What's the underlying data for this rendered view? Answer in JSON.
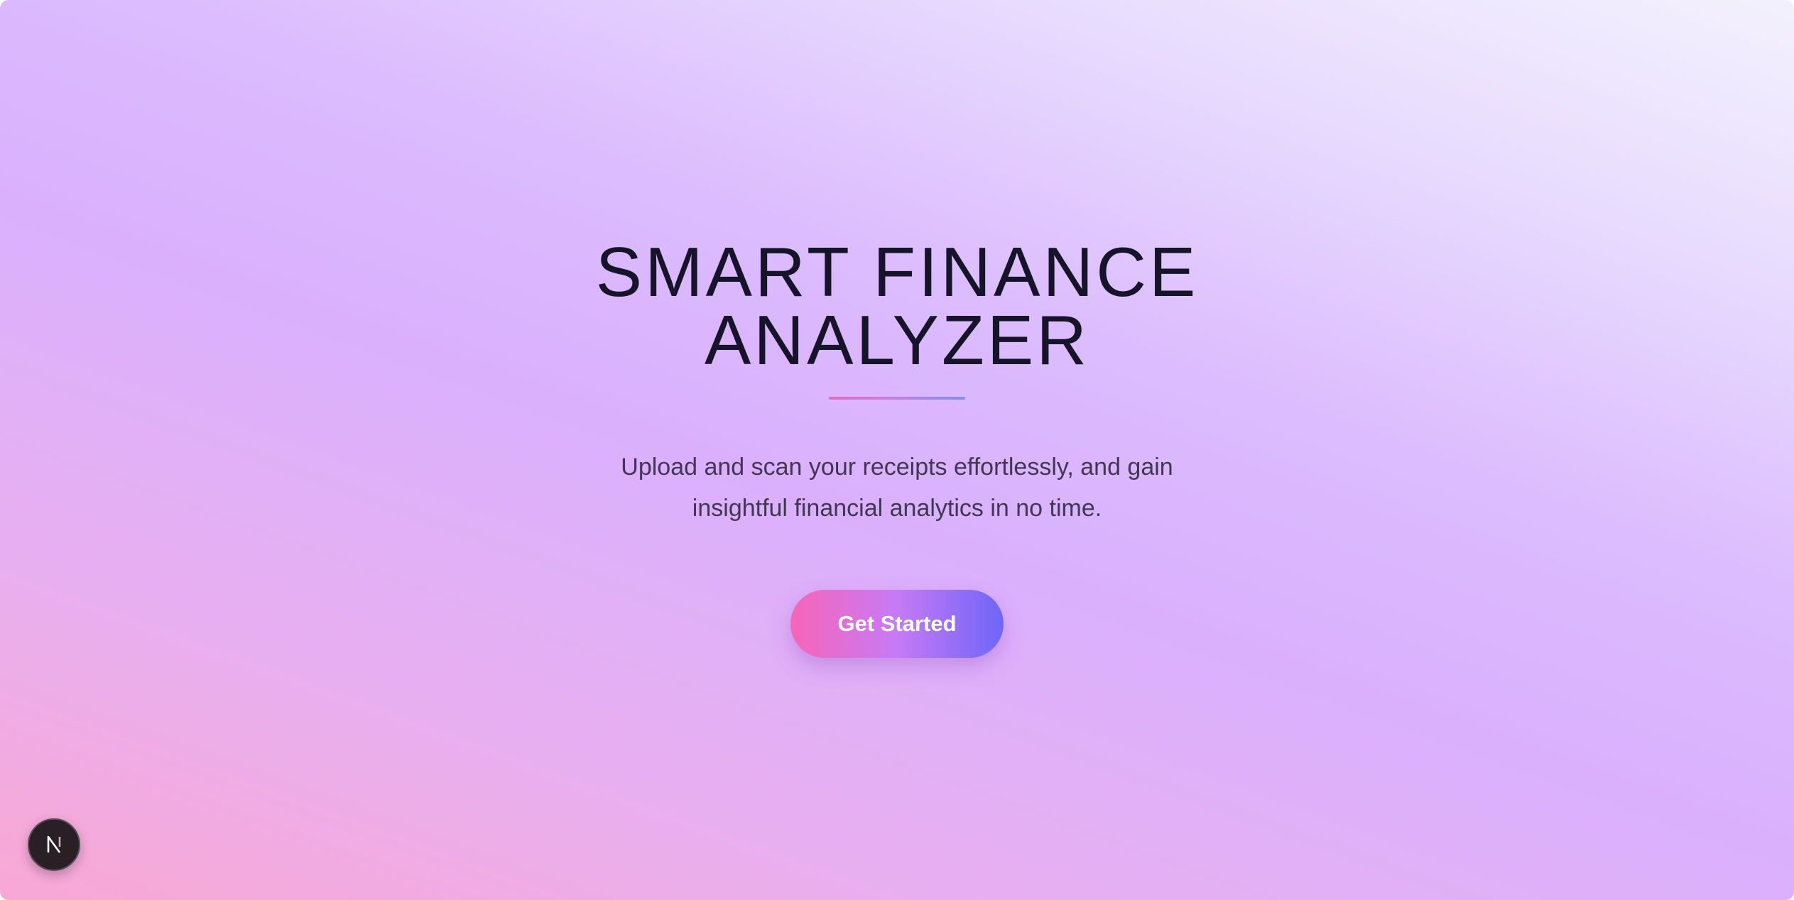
{
  "hero": {
    "title_line1": "SMART FINANCE",
    "title_line2": "ANALYZER",
    "subtitle_line1": "Upload and scan your receipts effortlessly, and gain",
    "subtitle_line2": "insightful financial analytics in no time.",
    "cta_label": "Get Started"
  },
  "badge": {
    "icon": "nextjs-logo-icon"
  },
  "colors": {
    "title": "#151428",
    "subtitle": "#413752",
    "cta_gradient_start": "#f765b8",
    "cta_gradient_end": "#6e66f7",
    "background_light": "#f3f1fd",
    "background_pink": "#f9a8d4",
    "background_purple": "#dab0fd"
  }
}
